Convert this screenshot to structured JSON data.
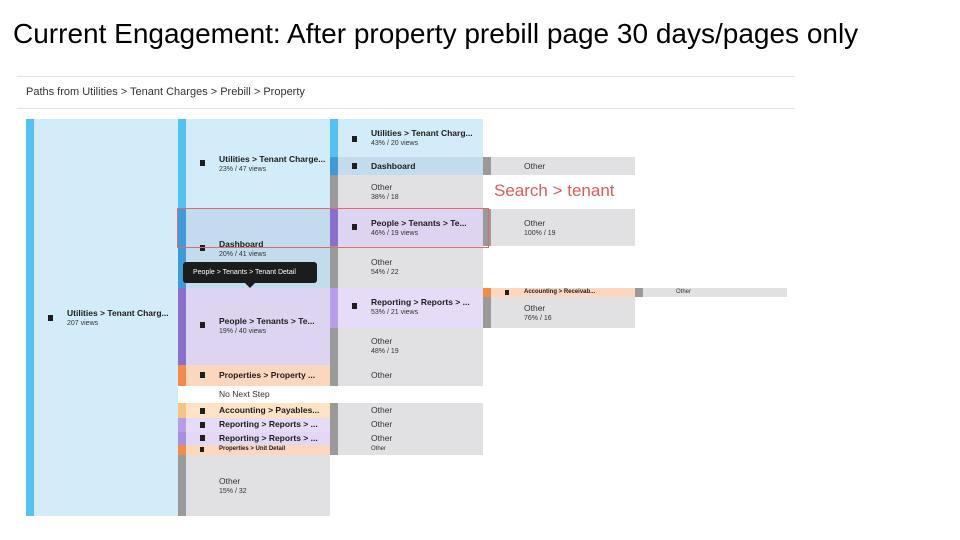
{
  "slide_title": "Current Engagement: After property prebill page 30 days/pages only",
  "breadcrumb": "Paths from Utilities > Tenant Charges > Prebill > Property",
  "annotation": "Search > tenant",
  "tooltip": "People > Tenants > Tenant Detail",
  "colors": {
    "blue_bar": "#55c1f2",
    "blue_bg": "#d3ecfa",
    "grey_bar": "#9a9a9a",
    "grey_bg": "#e1e1e3",
    "purple_bar": "#8a6fcc",
    "purple_bg": "#dcd4f0",
    "orange_bar": "#f28c4e",
    "orange_bg": "#fcd6bd",
    "peach_bar": "#f7c488",
    "peach_bg": "#fde3c4",
    "annotation": "#e05a5a"
  },
  "icons": {
    "page": "document-icon"
  },
  "col0": {
    "root": {
      "label": "Utilities > Tenant Charg...",
      "sub": "207 views"
    }
  },
  "col1": {
    "utilities": {
      "label": "Utilities > Tenant Charge...",
      "sub": "23% / 47 views"
    },
    "dashboard": {
      "label": "Dashboard",
      "sub": "20% / 41 views"
    },
    "people": {
      "label": "People > Tenants > Te...",
      "sub": "19% / 40 views"
    },
    "properties": {
      "label": "Properties > Property ..."
    },
    "no_next": {
      "label": "No Next Step"
    },
    "accounting": {
      "label": "Accounting > Payables..."
    },
    "reporting1": {
      "label": "Reporting > Reports > ..."
    },
    "reporting2": {
      "label": "Reporting > Reports > ..."
    },
    "unit_detail": {
      "label": "Properties > Unit Detail"
    },
    "other": {
      "label": "Other",
      "sub": "15% / 32"
    }
  },
  "col2": {
    "utilities": {
      "label": "Utilities > Tenant Charg...",
      "sub": "43% / 20 views"
    },
    "dashboard": {
      "label": "Dashboard"
    },
    "other1": {
      "label": "Other",
      "sub": "38% / 18"
    },
    "people": {
      "label": "People > Tenants > Te...",
      "sub": "46% / 19 views"
    },
    "other2": {
      "label": "Other",
      "sub": "54% / 22"
    },
    "reporting": {
      "label": "Reporting > Reports > ...",
      "sub": "53% / 21 views"
    },
    "other3": {
      "label": "Other",
      "sub": "48% / 19"
    },
    "other4": {
      "label": "Other"
    },
    "other5": {
      "label": "Other"
    },
    "other6": {
      "label": "Other"
    },
    "other7": {
      "label": "Other"
    },
    "other8": {
      "label": "Other"
    }
  },
  "col3": {
    "other_dash": {
      "label": "Other"
    },
    "other_people": {
      "label": "Other",
      "sub": "100% / 19"
    },
    "accounting_recv": {
      "label": "Accounting > Receivab..."
    },
    "other_rep": {
      "label": "Other",
      "sub": "76% / 16"
    }
  },
  "col4": {
    "other": {
      "label": "Other"
    }
  }
}
